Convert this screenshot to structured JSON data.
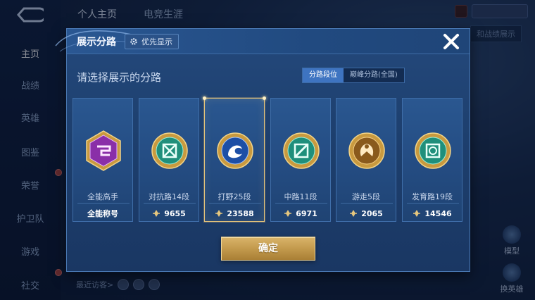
{
  "background": {
    "nav": [
      {
        "label": "主页",
        "active": true
      },
      {
        "label": "战绩",
        "active": false
      },
      {
        "label": "英雄",
        "active": false
      },
      {
        "label": "图鉴",
        "active": false
      },
      {
        "label": "荣誉",
        "active": false
      },
      {
        "label": "护卫队",
        "active": false
      },
      {
        "label": "游戏",
        "active": false
      },
      {
        "label": "社交",
        "active": false
      }
    ],
    "top_tabs": [
      "个人主页",
      "电竞生涯"
    ],
    "right_label": "和战绩展示",
    "side_tools": [
      "模型",
      "换英雄"
    ],
    "visitors_label": "最近访客>"
  },
  "modal": {
    "title": "展示分路",
    "priority_label": "优先显示",
    "subtitle": "请选择展示的分路",
    "toggle": {
      "options": [
        "分路段位",
        "巅峰分路(全国)"
      ],
      "active_index": 0
    },
    "cards": [
      {
        "name": "全能高手",
        "stat": "全能称号",
        "badge": "purple-hexagon-badge-icon",
        "selected": false
      },
      {
        "name": "对抗路14段",
        "stat": "9655",
        "badge": "sword-badge-icon",
        "selected": false
      },
      {
        "name": "打野25段",
        "stat": "23588",
        "badge": "dragon-badge-icon",
        "selected": true
      },
      {
        "name": "中路11段",
        "stat": "6971",
        "badge": "mid-lane-badge-icon",
        "selected": false
      },
      {
        "name": "游走5段",
        "stat": "2065",
        "badge": "roam-badge-icon",
        "selected": false
      },
      {
        "name": "发育路19段",
        "stat": "14546",
        "badge": "marksman-badge-icon",
        "selected": false
      }
    ],
    "confirm_label": "确定"
  },
  "colors": {
    "modal_bg": "#1f426f",
    "selected_border": "#e1c17a",
    "toggle_active": "#3e74c1",
    "confirm_gold": "#c39a4d"
  }
}
